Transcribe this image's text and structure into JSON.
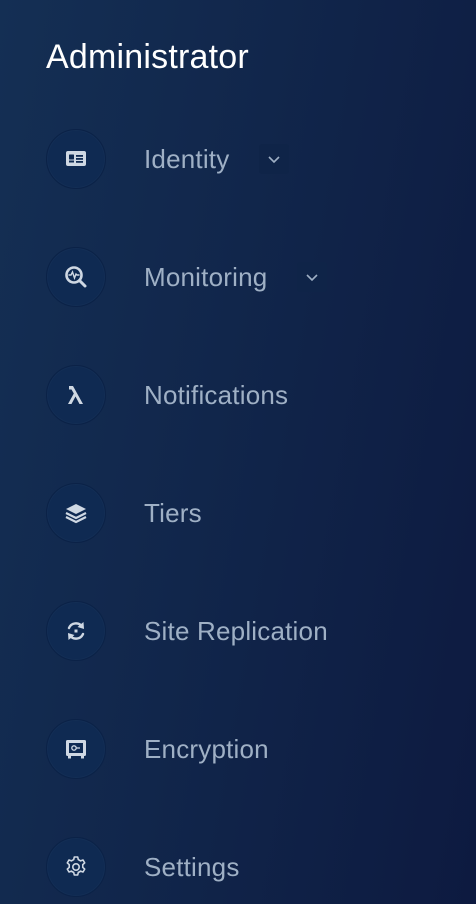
{
  "sidebar": {
    "section_title": "Administrator",
    "items": [
      {
        "label": "Identity",
        "icon": "id-card-icon",
        "expandable": true
      },
      {
        "label": "Monitoring",
        "icon": "monitor-search-icon",
        "expandable": true
      },
      {
        "label": "Notifications",
        "icon": "lambda-icon",
        "expandable": false
      },
      {
        "label": "Tiers",
        "icon": "layers-icon",
        "expandable": false
      },
      {
        "label": "Site Replication",
        "icon": "sync-icon",
        "expandable": false
      },
      {
        "label": "Encryption",
        "icon": "safe-icon",
        "expandable": false
      },
      {
        "label": "Settings",
        "icon": "gear-icon",
        "expandable": false
      }
    ]
  },
  "colors": {
    "background_start": "#142f54",
    "background_end": "#0d1a40",
    "icon_circle": "#0f2a52",
    "label_text": "#9fb0c5",
    "title_text": "#ffffff"
  }
}
